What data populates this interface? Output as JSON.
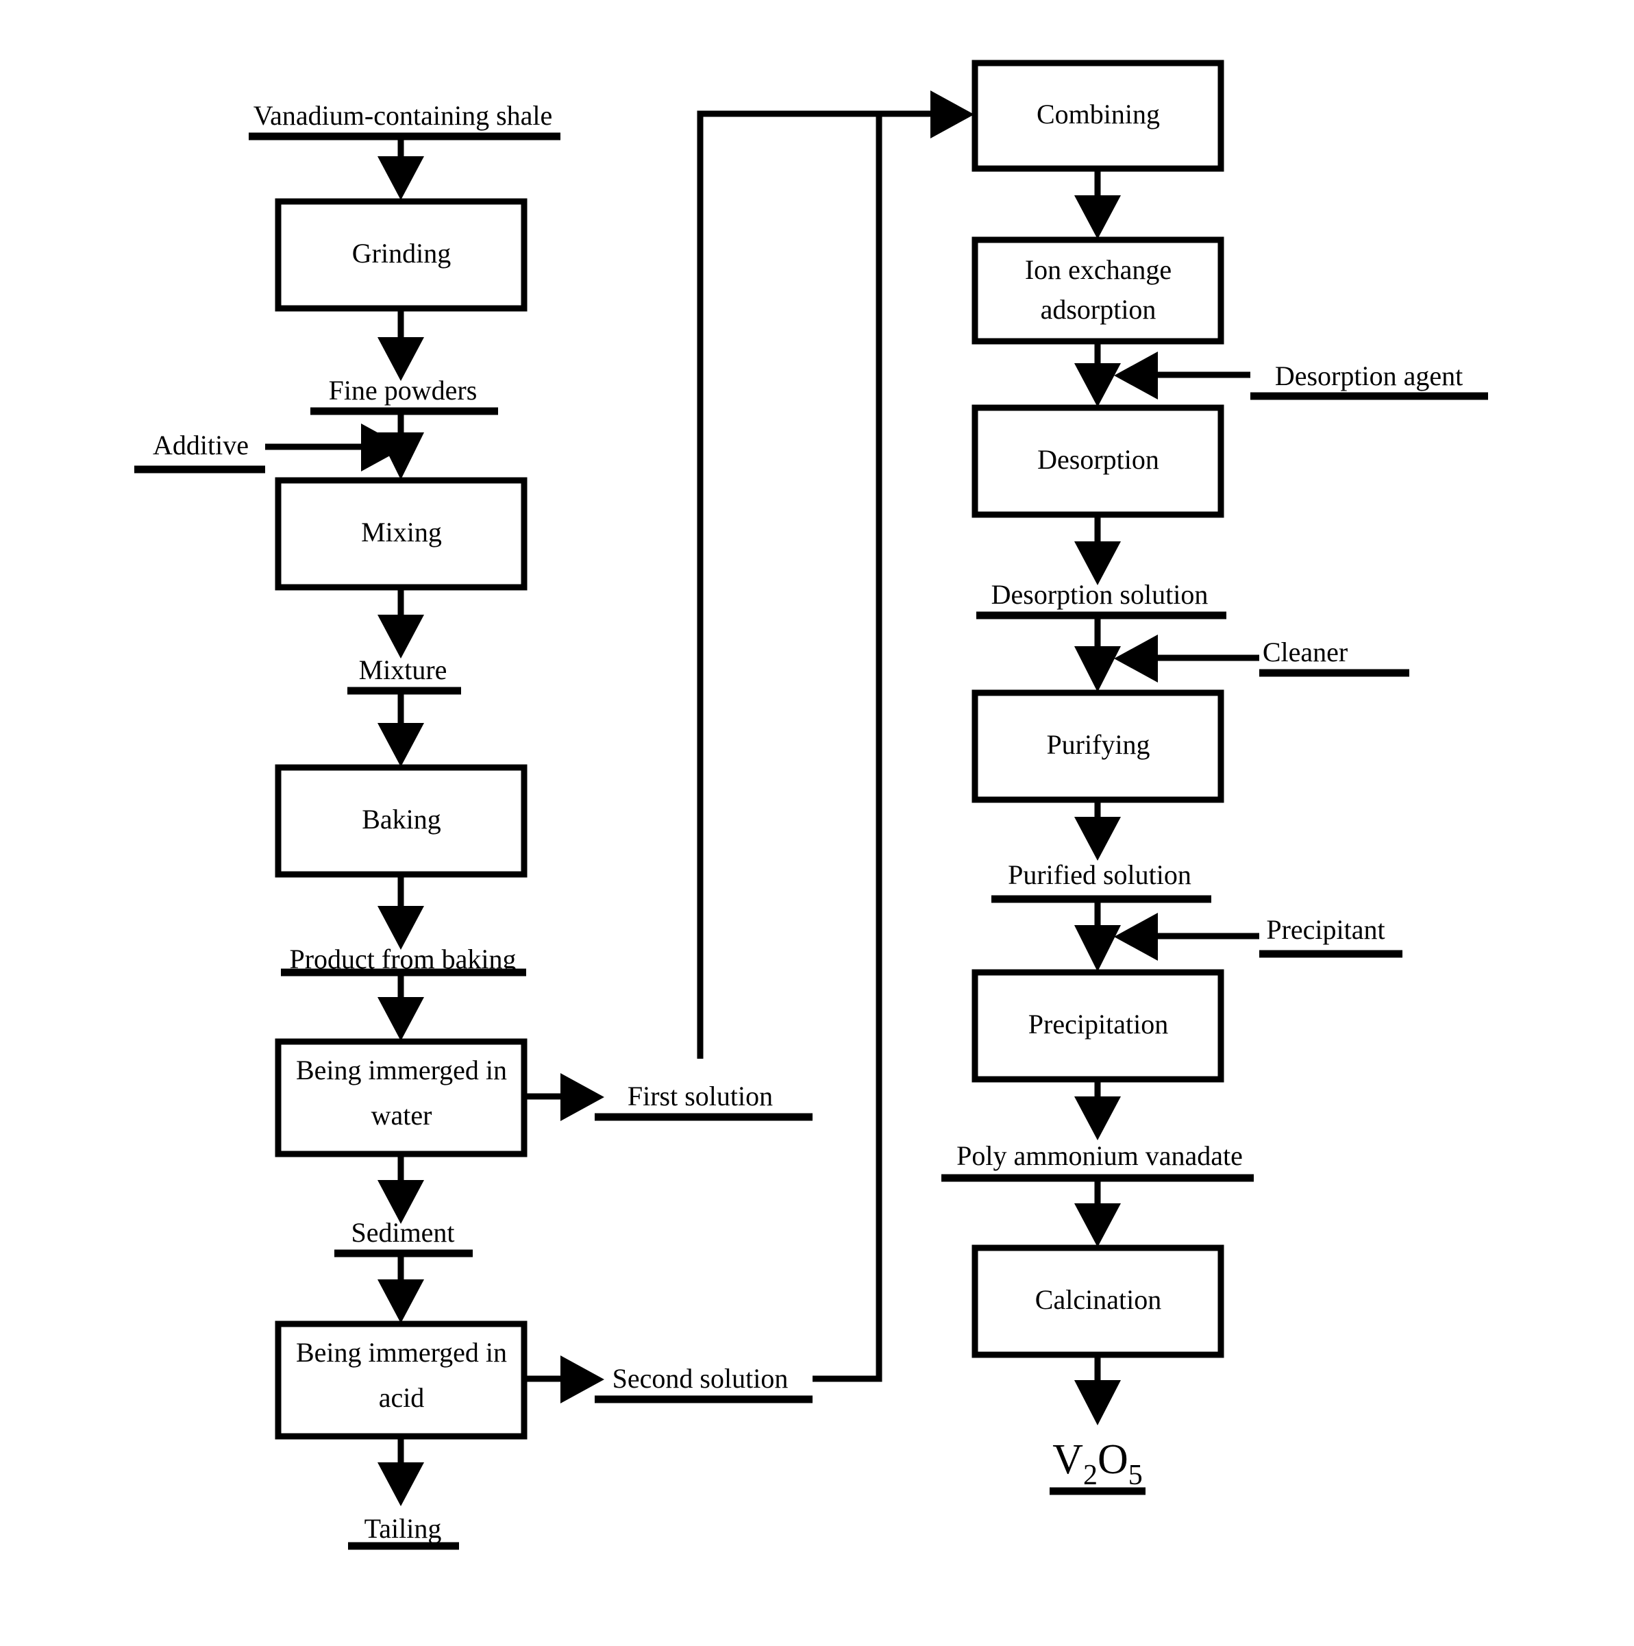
{
  "diagram": {
    "title": "Vanadium extraction process flow diagram",
    "type": "process-flowchart",
    "background_color": "#ffffff",
    "line_color": "#000000"
  },
  "left_column": {
    "input_label": "Vanadium-containing shale",
    "process_boxes": [
      {
        "id": "grinding",
        "label": "Grinding"
      },
      {
        "id": "mixing",
        "label": "Mixing"
      },
      {
        "id": "baking",
        "label": "Baking"
      },
      {
        "id": "immerged-water",
        "label_line1": "Being immerged in",
        "label_line2": "water"
      },
      {
        "id": "immerged-acid",
        "label_line1": "Being immerged in",
        "label_line2": "acid"
      }
    ],
    "intermediate_labels": [
      {
        "id": "fine-powders",
        "label": "Fine powders"
      },
      {
        "id": "mixture",
        "label": "Mixture"
      },
      {
        "id": "product-from-baking",
        "label": "Product from baking"
      },
      {
        "id": "sediment",
        "label": "Sediment"
      }
    ],
    "side_inputs": [
      {
        "id": "additive",
        "label": "Additive"
      }
    ],
    "side_outputs": [
      {
        "id": "first-solution",
        "label": "First solution"
      },
      {
        "id": "second-solution",
        "label": "Second solution"
      }
    ],
    "terminal_output": "Tailing"
  },
  "right_column": {
    "process_boxes": [
      {
        "id": "combining",
        "label": "Combining"
      },
      {
        "id": "ion-exchange",
        "label_line1": "Ion exchange",
        "label_line2": "adsorption"
      },
      {
        "id": "desorption",
        "label": "Desorption"
      },
      {
        "id": "purifying",
        "label": "Purifying"
      },
      {
        "id": "precipitation",
        "label": "Precipitation"
      },
      {
        "id": "calcination",
        "label": "Calcination"
      }
    ],
    "intermediate_labels": [
      {
        "id": "desorption-solution",
        "label": "Desorption solution"
      },
      {
        "id": "purified-solution",
        "label": "Purified solution"
      },
      {
        "id": "poly-ammonium-vanadate",
        "label": "Poly ammonium vanadate"
      }
    ],
    "side_inputs": [
      {
        "id": "desorption-agent",
        "label": "Desorption agent"
      },
      {
        "id": "cleaner",
        "label": "Cleaner"
      },
      {
        "id": "precipitant",
        "label": "Precipitant"
      }
    ],
    "final_product": {
      "id": "v2o5",
      "formula_main1": "V",
      "formula_sub1": "2",
      "formula_main2": "O",
      "formula_sub2": "5"
    }
  }
}
